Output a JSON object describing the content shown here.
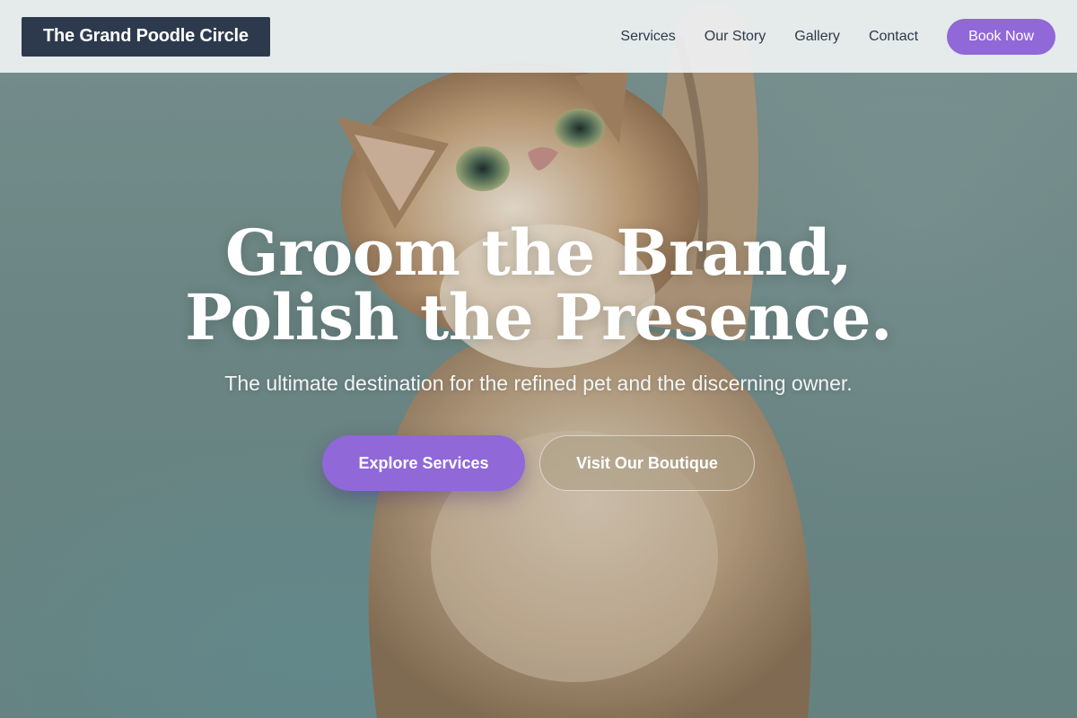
{
  "header": {
    "logo_text": "The Grand Poodle Circle",
    "nav": [
      {
        "label": "Services"
      },
      {
        "label": "Our Story"
      },
      {
        "label": "Gallery"
      },
      {
        "label": "Contact"
      }
    ],
    "cta_label": "Book Now"
  },
  "hero": {
    "title": "Groom the Brand, Polish the Presence.",
    "subtitle": "The ultimate destination for the refined pet and the discerning owner.",
    "primary_button": "Explore Services",
    "secondary_button": "Visit Our Boutique",
    "background_image_subject": "kitten-reaching-up"
  },
  "colors": {
    "accent": "#9168d8",
    "logo_background": "#2d3a4e",
    "header_background": "#eef1f2",
    "hero_background": "#728e8c"
  }
}
